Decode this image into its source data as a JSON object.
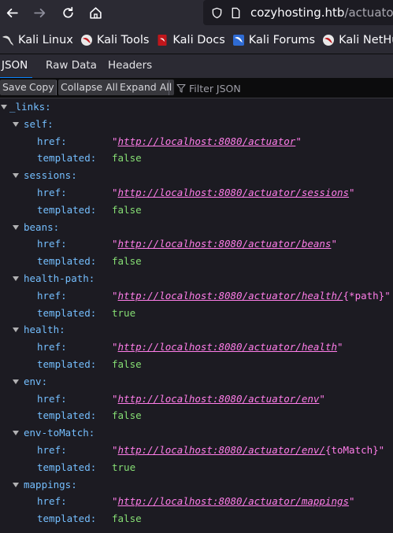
{
  "browser": {
    "url_host": "cozyhosting.htb",
    "url_path": "/actuator"
  },
  "bookmarks": [
    {
      "label": "Kali Linux",
      "icon": "kali-dragon-icon"
    },
    {
      "label": "Kali Tools",
      "icon": "kali-tools-icon"
    },
    {
      "label": "Kali Docs",
      "icon": "kali-docs-icon"
    },
    {
      "label": "Kali Forums",
      "icon": "kali-forums-icon"
    },
    {
      "label": "Kali NetHunter",
      "icon": "kali-nethunter-icon"
    }
  ],
  "viewer_tabs": {
    "json": "JSON",
    "raw": "Raw Data",
    "headers": "Headers"
  },
  "toolbar": {
    "save": "Save",
    "copy": "Copy",
    "collapse_all": "Collapse All",
    "expand_all": "Expand All",
    "filter_placeholder": "Filter JSON"
  },
  "json": {
    "root_key": "_links:",
    "href_key": "href:",
    "templated_key": "templated:",
    "entries": [
      {
        "key": "self:",
        "href_link": "http://localhost:8080/actuator",
        "href_suffix": "",
        "templated": "false"
      },
      {
        "key": "sessions:",
        "href_link": "http://localhost:8080/actuator/sessions",
        "href_suffix": "",
        "templated": "false"
      },
      {
        "key": "beans:",
        "href_link": "http://localhost:8080/actuator/beans",
        "href_suffix": "",
        "templated": "false"
      },
      {
        "key": "health-path:",
        "href_link": "http://localhost:8080/actuator/health/",
        "href_suffix": "{*path}",
        "templated": "true"
      },
      {
        "key": "health:",
        "href_link": "http://localhost:8080/actuator/health",
        "href_suffix": "",
        "templated": "false"
      },
      {
        "key": "env:",
        "href_link": "http://localhost:8080/actuator/env",
        "href_suffix": "",
        "templated": "false"
      },
      {
        "key": "env-toMatch:",
        "href_link": "http://localhost:8080/actuator/env/",
        "href_suffix": "{toMatch}",
        "templated": "true"
      },
      {
        "key": "mappings:",
        "href_link": "http://localhost:8080/actuator/mappings",
        "href_suffix": "",
        "templated": "false"
      }
    ]
  },
  "colors": {
    "key": "#75bfff",
    "string": "#ff7de9",
    "boolean": "#86de74",
    "background": "#1c1b22",
    "toolbar": "#0c0c0d"
  }
}
